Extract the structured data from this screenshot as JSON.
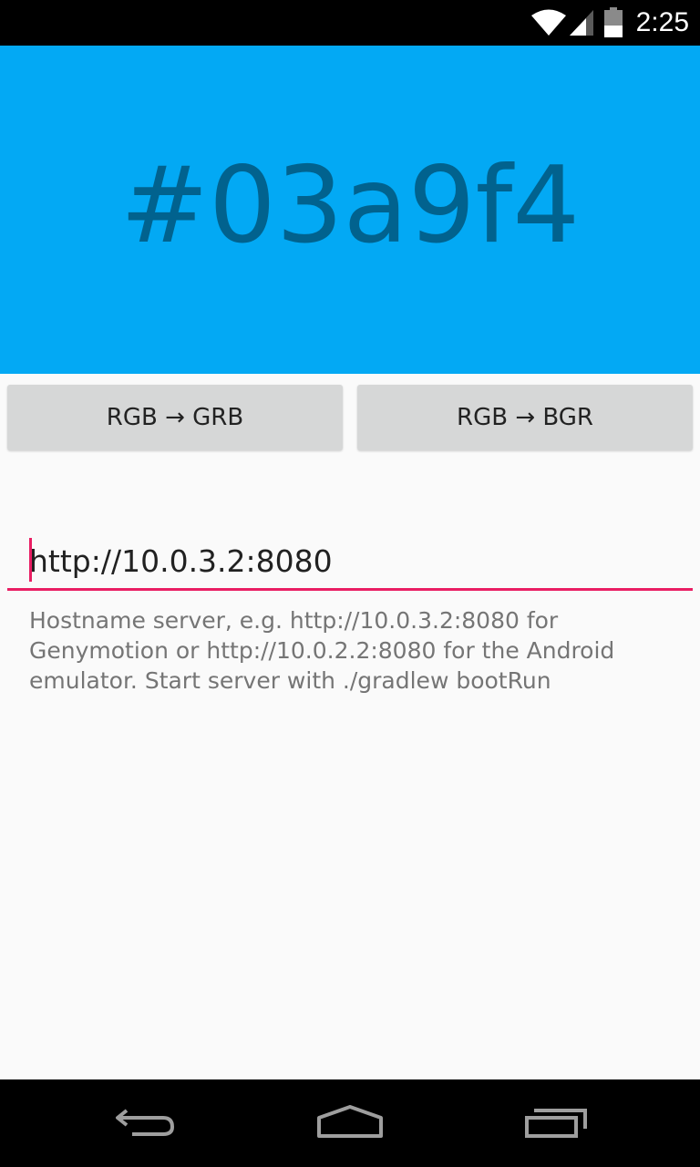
{
  "status_bar": {
    "time": "2:25",
    "icons": [
      "wifi-icon",
      "cell-signal-icon",
      "battery-icon"
    ]
  },
  "color_preview": {
    "hex": "#03a9f4",
    "background": "#03a9f4"
  },
  "buttons": {
    "rgb_to_grb": "RGB → GRB",
    "rgb_to_bgr": "RGB → BGR"
  },
  "server_field": {
    "value": "http://10.0.3.2:8080",
    "accent": "#e91e63",
    "helper": "Hostname server, e.g. http://10.0.3.2:8080 for Genymotion or http://10.0.2.2:8080 for the Android emulator. Start server with ./gradlew bootRun"
  },
  "nav_bar": {
    "icons": [
      "back-icon",
      "home-icon",
      "recents-icon"
    ]
  }
}
